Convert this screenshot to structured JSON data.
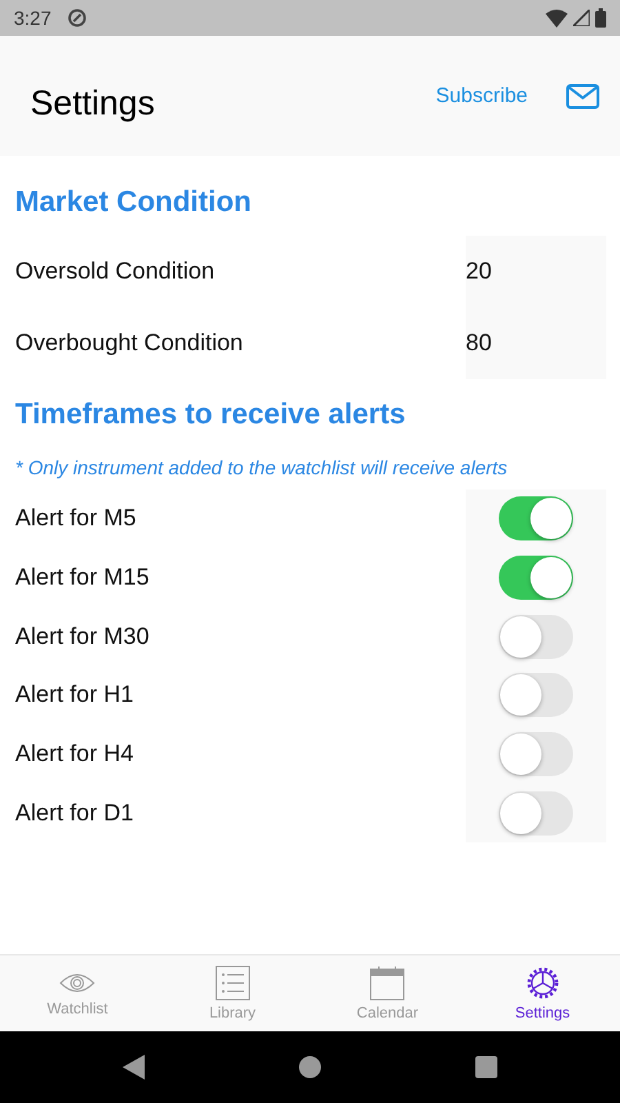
{
  "status_bar": {
    "time": "3:27"
  },
  "header": {
    "title": "Settings",
    "subscribe": "Subscribe"
  },
  "market": {
    "heading": "Market Condition",
    "fields": [
      {
        "label": "Oversold Condition",
        "value": "20"
      },
      {
        "label": "Overbought Condition",
        "value": "80"
      }
    ]
  },
  "alerts": {
    "heading": "Timeframes to receive alerts",
    "note": "* Only instrument added to the watchlist will receive alerts",
    "items": [
      {
        "label": "Alert for M5",
        "on": true
      },
      {
        "label": "Alert for M15",
        "on": true
      },
      {
        "label": "Alert for M30",
        "on": false
      },
      {
        "label": "Alert for H1",
        "on": false
      },
      {
        "label": "Alert for H4",
        "on": false
      },
      {
        "label": "Alert for D1",
        "on": false
      }
    ]
  },
  "tabs": [
    {
      "label": "Watchlist",
      "kind": "eye",
      "selected": false
    },
    {
      "label": "Library",
      "kind": "list",
      "selected": false
    },
    {
      "label": "Calendar",
      "kind": "calendar",
      "selected": false
    },
    {
      "label": "Settings",
      "kind": "gear",
      "selected": true
    }
  ]
}
